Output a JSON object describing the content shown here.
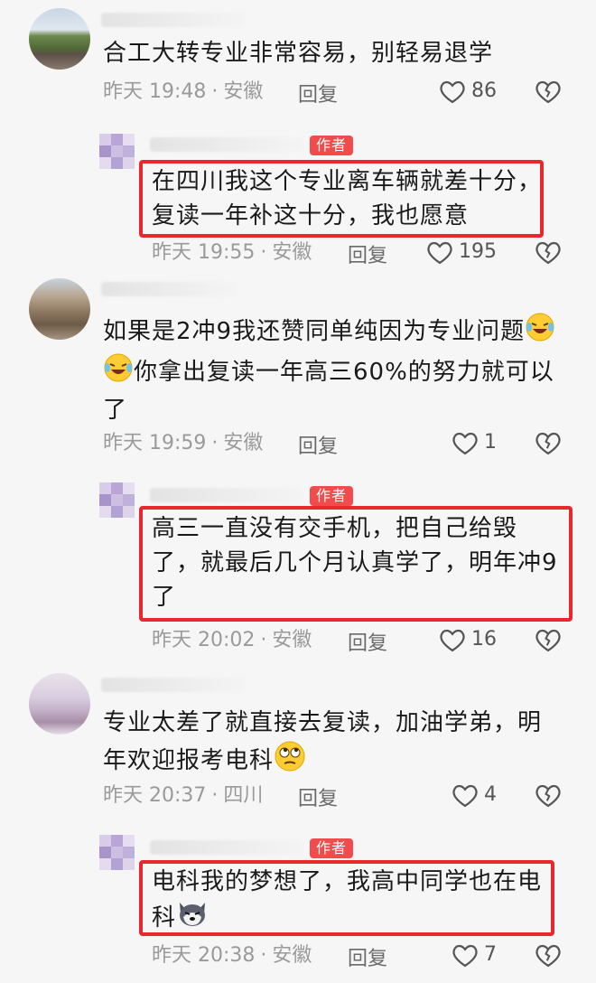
{
  "comments": [
    {
      "text_lines": [
        "合工大转专业非常容易，别轻易退学"
      ],
      "time": "昨天 19:48",
      "sep": "·",
      "location": "安徽",
      "reply_label": "回复",
      "likes": "86",
      "like_icon": "heart-outline-icon",
      "dislike_icon": "broken-heart-icon"
    },
    {
      "is_author": true,
      "badge": "作者",
      "text_lines": [
        "在四川我这个专业离车辆就差十分，",
        "复读一年补这十分，我也愿意"
      ],
      "time": "昨天 19:55",
      "sep": "·",
      "location": "安徽",
      "reply_label": "回复",
      "likes": "195"
    },
    {
      "text_lines": [
        "如果是2冲9我还赞同单纯因为专业问题",
        "你拿出复读一年高三60%的努力就可以",
        "了"
      ],
      "emojis": [
        "laughing-crying-emoji",
        "laughing-crying-emoji"
      ],
      "time": "昨天 19:59",
      "sep": "·",
      "location": "安徽",
      "reply_label": "回复",
      "likes": "1"
    },
    {
      "is_author": true,
      "badge": "作者",
      "text_lines": [
        "高三一直没有交手机，把自己给毁",
        "了，就最后几个月认真学了，明年冲9",
        "了"
      ],
      "time": "昨天 20:02",
      "sep": "·",
      "location": "安徽",
      "reply_label": "回复",
      "likes": "16"
    },
    {
      "text_lines": [
        "专业太差了就直接去复读，加油学弟，明",
        "年欢迎报考电科"
      ],
      "emojis": [
        "rolling-eyes-emoji"
      ],
      "time": "昨天 20:37",
      "sep": "·",
      "location": "四川",
      "reply_label": "回复",
      "likes": "4"
    },
    {
      "is_author": true,
      "badge": "作者",
      "text_lines": [
        "电科我的梦想了，我高中同学也在电",
        "科"
      ],
      "emojis": [
        "husky-dog-emoji"
      ],
      "time": "昨天 20:38",
      "sep": "·",
      "location": "安徽",
      "reply_label": "回复",
      "likes": "7"
    }
  ],
  "colors": {
    "highlight_box": "#e8282e",
    "author_badge": "#f24b4b",
    "meta_text": "#9a9a9a",
    "background": "#f6f6f6"
  }
}
